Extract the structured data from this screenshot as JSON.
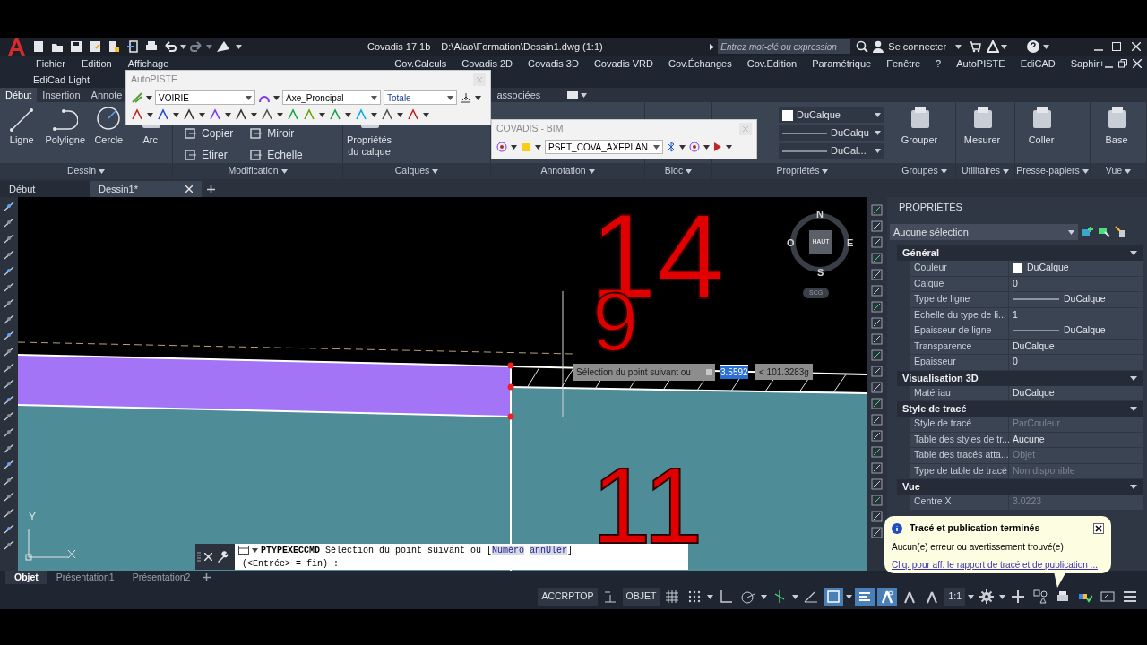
{
  "title_bar": {
    "app": "Covadis 17.1b",
    "file": "D:\\Alao\\Formation\\Dessin1.dwg (1:1)",
    "search_placeholder": "Entrez mot-clé ou expression",
    "sign_in": "Se connecter"
  },
  "menu_bar": {
    "left": [
      "Fichier",
      "Edition",
      "Affichage"
    ],
    "right": [
      "Cov.Calculs",
      "Covadis 2D",
      "Covadis 3D",
      "Covadis VRD",
      "Cov.Échanges",
      "Cov.Edition",
      "Paramétrique",
      "Fenêtre",
      "?",
      "AutoPISTE",
      "EdiCAD",
      "Saphir+"
    ],
    "second_row": [
      "EdiCad Light"
    ]
  },
  "ribbon": {
    "tabs": [
      {
        "label": "Début",
        "selected": true
      },
      {
        "label": "Insertion",
        "selected": false
      },
      {
        "label": "Annote",
        "selected": false
      }
    ],
    "tabs_right": [
      {
        "label": "associées",
        "selected": false
      }
    ],
    "panels": [
      {
        "title": "Dessin",
        "tools": [
          {
            "kind": "large",
            "label": "Ligne"
          },
          {
            "kind": "large",
            "label": "Polyligne"
          },
          {
            "kind": "large",
            "label": "Cercle"
          },
          {
            "kind": "large",
            "label": "Arc"
          }
        ]
      },
      {
        "title": "Modification",
        "tools": [
          {
            "kind": "small",
            "label": "Copier"
          },
          {
            "kind": "small",
            "label": "Miroir"
          },
          {
            "kind": "small",
            "label": "Etirer"
          },
          {
            "kind": "small",
            "label": "Echelle"
          }
        ]
      },
      {
        "title": "Calques",
        "tools": [
          {
            "kind": "large",
            "label": "Propriétés du calque"
          }
        ]
      },
      {
        "title": "Annotation"
      },
      {
        "title": "Bloc"
      },
      {
        "title": "Propriétés",
        "tools": [
          {
            "kind": "color-dropdown",
            "label": "DuCalque"
          },
          {
            "kind": "line-dropdown",
            "label": "DuCalqu"
          },
          {
            "kind": "line-dropdown",
            "label": "DuCal..."
          }
        ]
      },
      {
        "title": "Groupes",
        "tools": [
          {
            "kind": "large",
            "label": "Grouper"
          }
        ]
      },
      {
        "title": "Utilitaires",
        "tools": [
          {
            "kind": "large",
            "label": "Mesurer"
          }
        ]
      },
      {
        "title": "Presse-papiers",
        "tools": [
          {
            "kind": "large",
            "label": "Coller"
          }
        ]
      },
      {
        "title": "Vue",
        "tools": [
          {
            "kind": "large",
            "label": "Base"
          }
        ]
      }
    ]
  },
  "file_tabs": [
    {
      "label": "Début",
      "selected": false
    },
    {
      "label": "Dessin1*",
      "selected": true
    }
  ],
  "autopiste_window": {
    "title": "AutoPISTE",
    "fields": [
      "VOIRIE",
      "Axe_Proncipal",
      "Totale"
    ]
  },
  "bim_window": {
    "title": "COVADIS - BIM",
    "field": "PSET_COVA_AXEPLAN"
  },
  "canvas": {
    "labels": [
      {
        "text": "14"
      },
      {
        "text": "9"
      },
      {
        "text": "11"
      }
    ],
    "compass": {
      "north": "N",
      "west": "O",
      "top": "HAUT",
      "east": "E",
      "south": "S",
      "ucs": "SCG"
    },
    "ucs_axis": "Y",
    "dynamic_input": {
      "prompt": "Sélection du point suivant ou",
      "value": "3.5592",
      "angle": "< 101.3283g"
    }
  },
  "command_line": {
    "command": "PTYPEXECCMD",
    "prompt": "Sélection du point suivant ou [",
    "options": [
      "Numéro",
      "annUler"
    ],
    "prompt_end": "]",
    "second_line": "(<Entrée> = fin) :"
  },
  "properties": {
    "title": "PROPRIÉTÉS",
    "selection": "Aucune sélection",
    "sections": [
      {
        "title": "Général",
        "expanded": true,
        "rows": [
          {
            "label": "Couleur",
            "value": "DuCalque",
            "kind": "color",
            "disabled": false
          },
          {
            "label": "Calque",
            "value": "0",
            "kind": "text",
            "disabled": false
          },
          {
            "label": "Type de ligne",
            "value": "DuCalque",
            "kind": "line",
            "disabled": false
          },
          {
            "label": "Echelle du type de li...",
            "value": "1",
            "kind": "text",
            "disabled": false
          },
          {
            "label": "Epaisseur de ligne",
            "value": "DuCalque",
            "kind": "line",
            "disabled": false
          },
          {
            "label": "Transparence",
            "value": "DuCalque",
            "kind": "text",
            "disabled": false
          },
          {
            "label": "Epaisseur",
            "value": "0",
            "kind": "text",
            "disabled": false
          }
        ]
      },
      {
        "title": "Visualisation 3D",
        "expanded": true,
        "rows": [
          {
            "label": "Matériau",
            "value": "DuCalque",
            "kind": "text",
            "disabled": false
          }
        ]
      },
      {
        "title": "Style de tracé",
        "expanded": true,
        "rows": [
          {
            "label": "Style de tracé",
            "value": "ParCouleur",
            "kind": "text",
            "disabled": true
          },
          {
            "label": "Table des styles de tr...",
            "value": "Aucune",
            "kind": "text",
            "disabled": false
          },
          {
            "label": "Table des tracés atta...",
            "value": "Objet",
            "kind": "text",
            "disabled": true
          },
          {
            "label": "Type de table de tracé",
            "value": "Non disponible",
            "kind": "text",
            "disabled": true
          }
        ]
      },
      {
        "title": "Vue",
        "expanded": true,
        "rows": [
          {
            "label": "Centre X",
            "value": "3.0223",
            "kind": "text",
            "disabled": true
          }
        ]
      }
    ]
  },
  "layout_tabs": [
    {
      "label": "Objet",
      "selected": true
    },
    {
      "label": "Présentation1",
      "selected": false
    },
    {
      "label": "Présentation2",
      "selected": false
    }
  ],
  "status_bar": {
    "items": [
      {
        "kind": "text",
        "label": "ACCRPTOP"
      },
      {
        "kind": "text",
        "label": "OBJET"
      },
      {
        "kind": "text",
        "label": "1:1"
      }
    ]
  },
  "notification": {
    "title": "Tracé et publication terminés",
    "message": "Aucun(e) erreur ou avertissement trouvé(e)",
    "link": "Cliq. pour aff. le rapport de tracé et de publication ..."
  }
}
